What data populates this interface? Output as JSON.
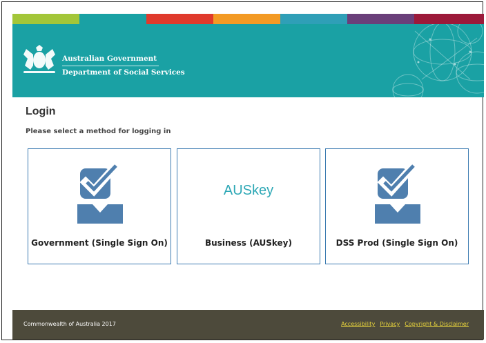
{
  "header": {
    "color_strip": [
      "#a3c639",
      "#1aa1a4",
      "#e03a2c",
      "#f39a24",
      "#1aa1a4",
      "#6a3f7a",
      "#9c1a3a"
    ],
    "gov_line1": "Australian Government",
    "gov_line2": "Department of Social Services",
    "crest_icon": "coat-of-arms-icon",
    "banner_color": "#1aa1a4"
  },
  "main": {
    "title": "Login",
    "subtitle": "Please select a method for logging in",
    "cards": [
      {
        "label": "Government (Single Sign On)",
        "icon": "user-check-icon"
      },
      {
        "label": "Business (AUSkey)",
        "logo_text": "AUSkey"
      },
      {
        "label": "DSS Prod (Single Sign On)",
        "icon": "user-check-icon"
      }
    ]
  },
  "footer": {
    "copyright": "Commonwealth of Australia 2017",
    "links": [
      "Accessibility",
      "Privacy",
      "Copyright & Disclaimer"
    ]
  }
}
